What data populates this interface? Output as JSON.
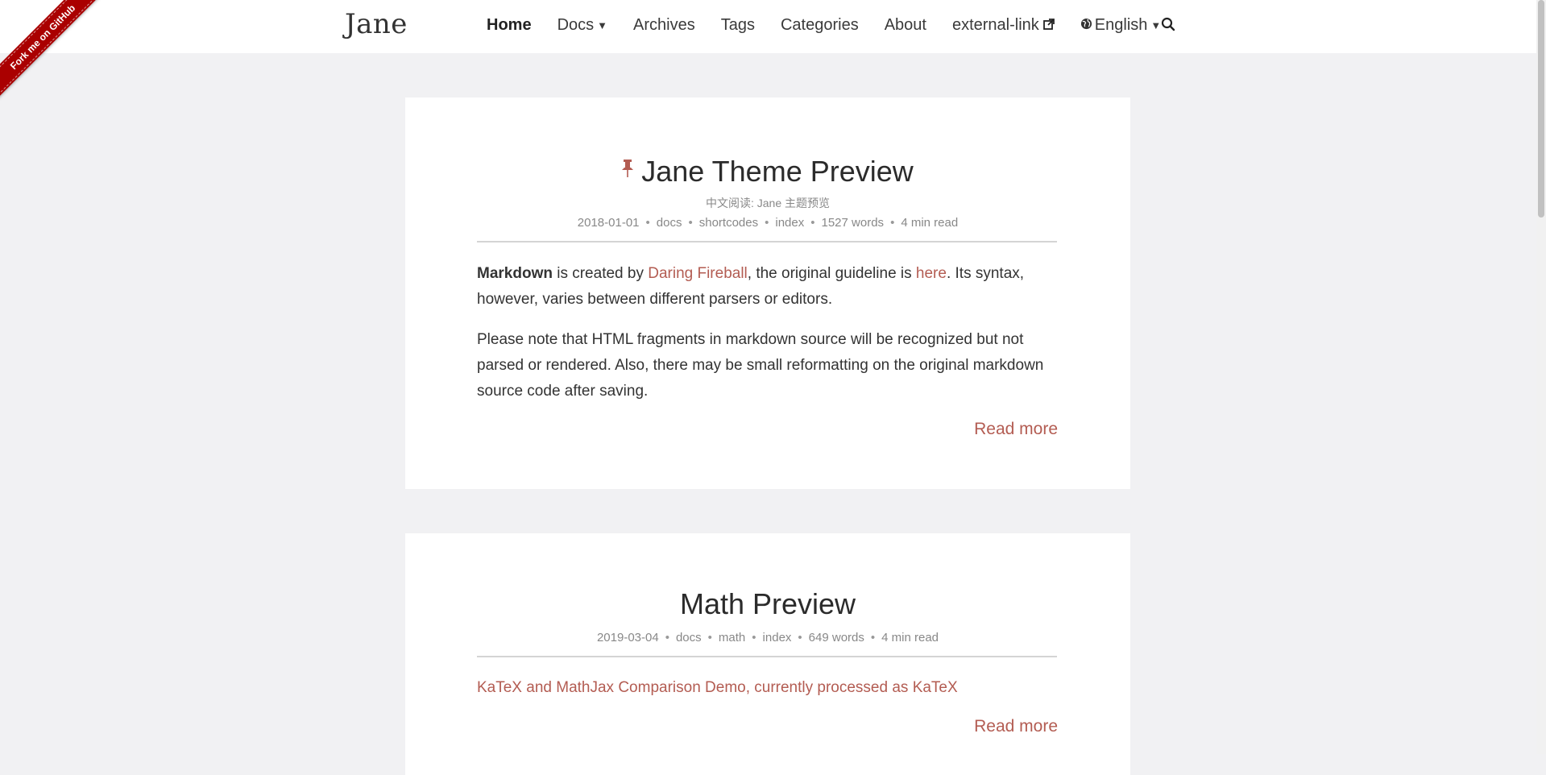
{
  "site": {
    "logo": "Jane"
  },
  "nav": {
    "home": "Home",
    "docs": "Docs",
    "archives": "Archives",
    "tags": "Tags",
    "categories": "Categories",
    "about": "About",
    "external": "external-link",
    "language": "English"
  },
  "ribbon": {
    "text": "Fork me on GitHub"
  },
  "posts": [
    {
      "title": "Jane Theme Preview",
      "subtitle": "中文阅读: Jane 主题预览",
      "date": "2018-01-01",
      "tags": [
        "docs",
        "shortcodes",
        "index"
      ],
      "words": "1527 words",
      "read_time": "4 min read",
      "para1": {
        "bold": "Markdown",
        "t1": " is created by ",
        "link1": "Daring Fireball",
        "t2": ", the original guideline is ",
        "link2": "here",
        "t3": ". Its syntax, however, varies between different parsers or editors."
      },
      "para2": "Please note that HTML fragments in markdown source will be recognized but not parsed or rendered. Also, there may be small reformatting on the original markdown source code after saving.",
      "read_more": "Read more"
    },
    {
      "title": "Math Preview",
      "date": "2019-03-04",
      "tags": [
        "docs",
        "math",
        "index"
      ],
      "words": "649 words",
      "read_time": "4 min read",
      "summary": "KaTeX and MathJax Comparison Demo, currently processed as KaTeX",
      "read_more": "Read more"
    }
  ],
  "colors": {
    "accent": "#b35c52",
    "ribbon": "#aa0000",
    "background": "#f1f1f3"
  }
}
